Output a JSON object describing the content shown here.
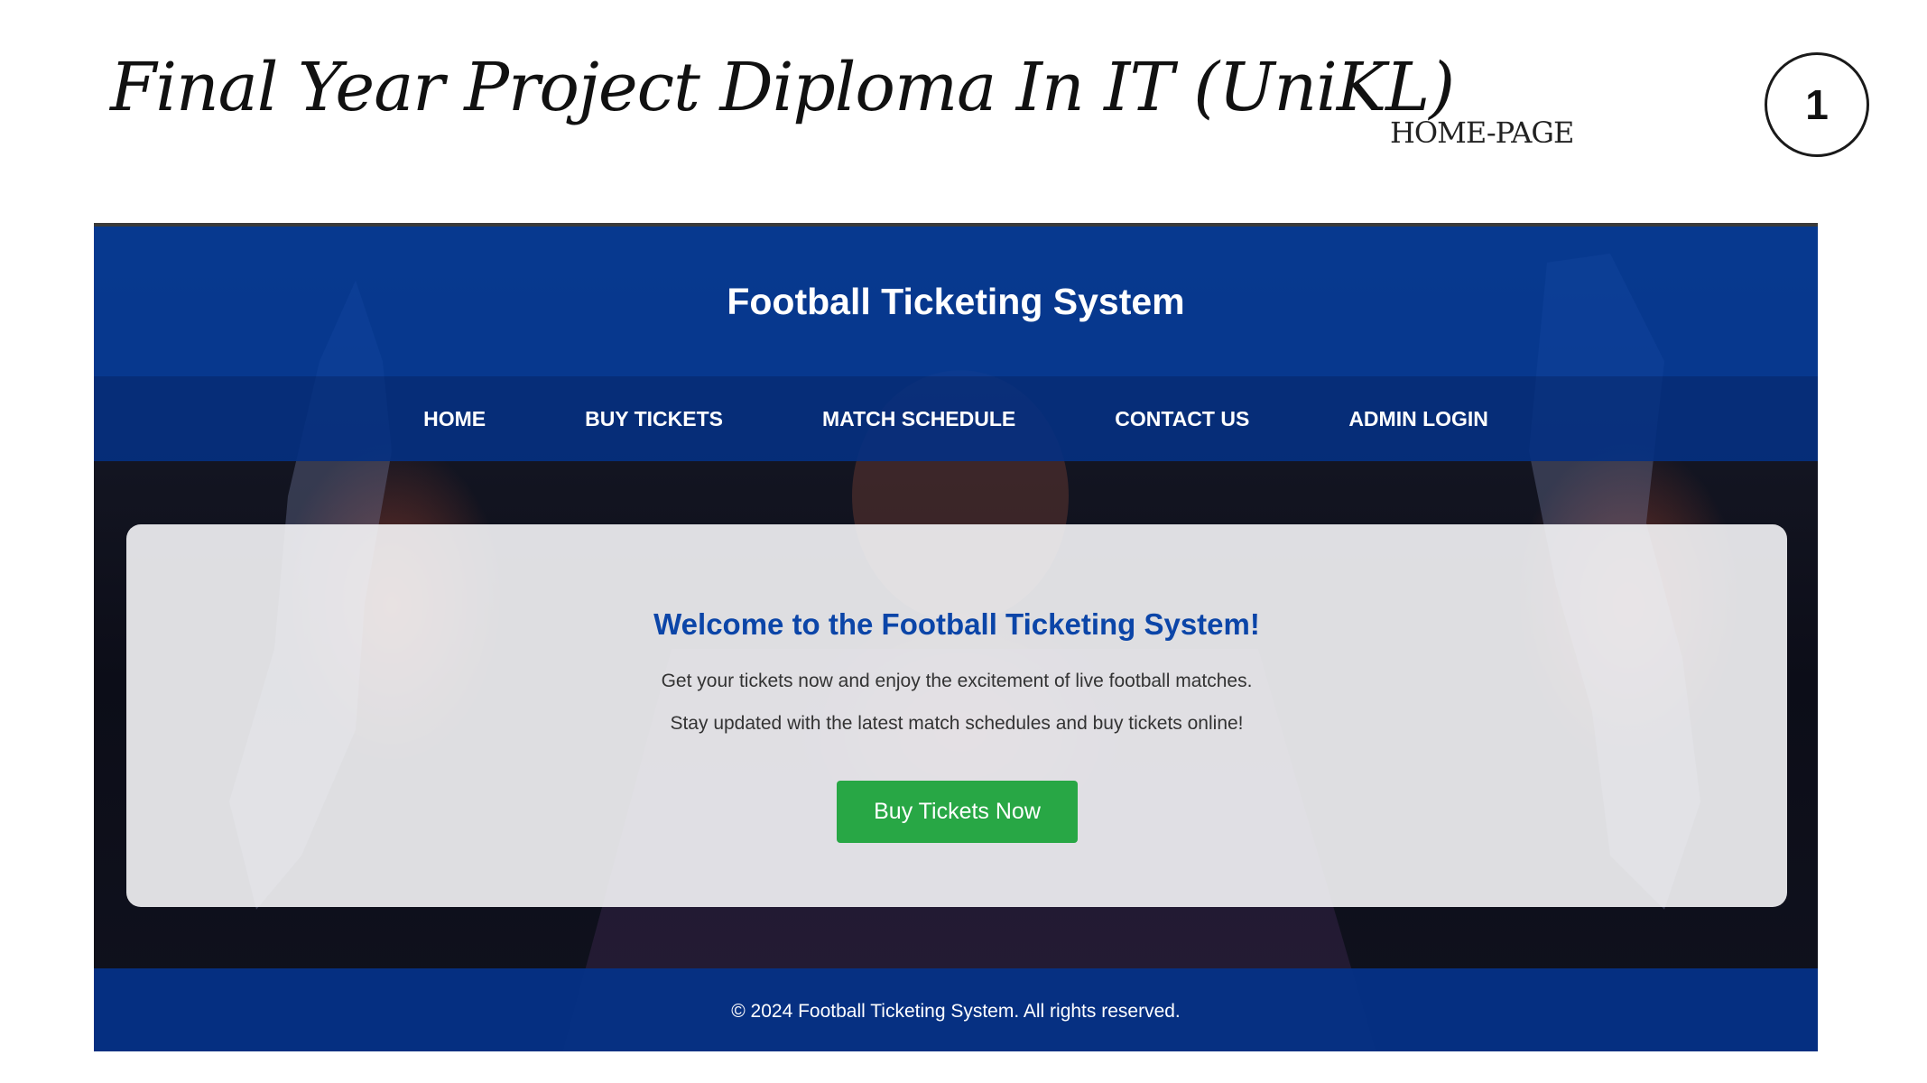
{
  "slide": {
    "title": "Final Year Project Diploma In IT (UniKL)",
    "section_label": "HOME-PAGE",
    "page_number": "1"
  },
  "website": {
    "header": {
      "title": "Football Ticketing System"
    },
    "nav": {
      "items": [
        {
          "label": "HOME"
        },
        {
          "label": "BUY TICKETS"
        },
        {
          "label": "MATCH SCHEDULE"
        },
        {
          "label": "CONTACT US"
        },
        {
          "label": "ADMIN LOGIN"
        }
      ]
    },
    "welcome": {
      "heading": "Welcome to the Football Ticketing System!",
      "line1": "Get your tickets now and enjoy the excitement of live football matches.",
      "line2": "Stay updated with the latest match schedules and buy tickets online!",
      "button_label": "Buy Tickets Now"
    },
    "footer": {
      "text": "© 2024 Football Ticketing System. All rights reserved."
    },
    "colors": {
      "header_blue": "#053ea0",
      "nav_blue": "#043082",
      "heading_blue": "#0b45a8",
      "button_green": "#28a745",
      "footer_blue": "#053287"
    }
  }
}
